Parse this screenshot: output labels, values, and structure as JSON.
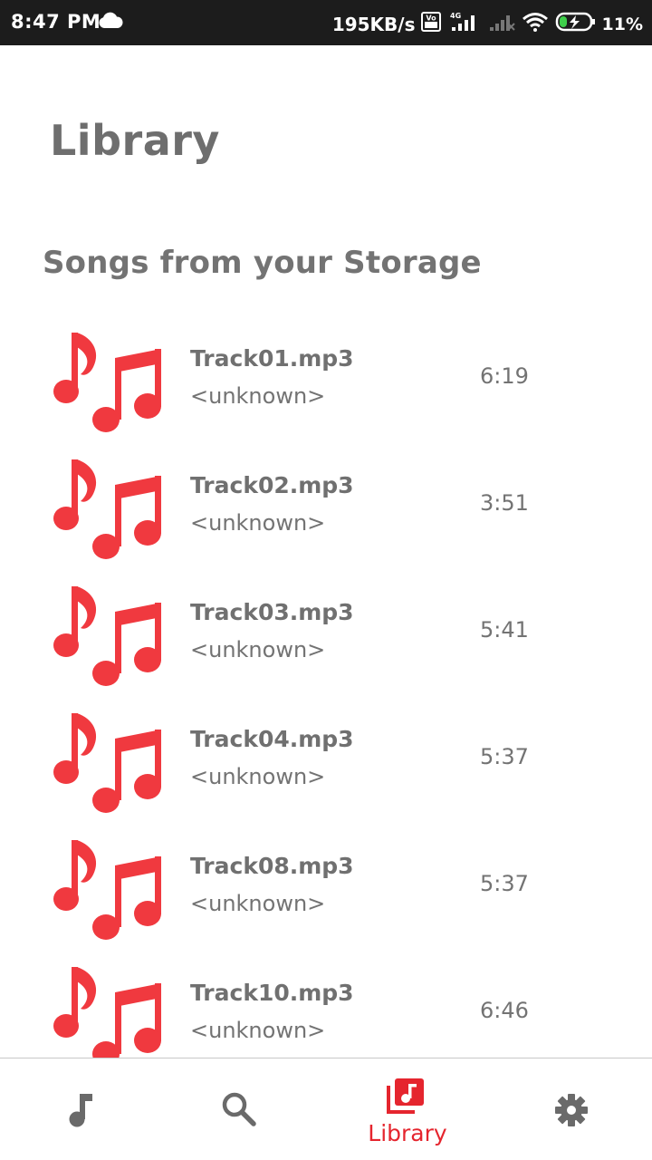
{
  "status_bar": {
    "time": "8:47 PM",
    "speed": "195KB/s",
    "battery": "11%",
    "icons": [
      "cloud-icon",
      "volte-icon",
      "signal-4g-icon",
      "signal-icon",
      "wifi-icon",
      "battery-charging-icon"
    ]
  },
  "header": {
    "title": "Library"
  },
  "section": {
    "title": "Songs from your Storage"
  },
  "songs": [
    {
      "title": "Track01.mp3",
      "artist": "<unknown>",
      "duration": "6:19"
    },
    {
      "title": "Track02.mp3",
      "artist": "<unknown>",
      "duration": "3:51"
    },
    {
      "title": "Track03.mp3",
      "artist": "<unknown>",
      "duration": "5:41"
    },
    {
      "title": "Track04.mp3",
      "artist": "<unknown>",
      "duration": "5:37"
    },
    {
      "title": "Track08.mp3",
      "artist": "<unknown>",
      "duration": "5:37"
    },
    {
      "title": "Track10.mp3",
      "artist": "<unknown>",
      "duration": "6:46"
    }
  ],
  "bottom_nav": {
    "items": [
      {
        "icon": "music-note-icon",
        "label": "",
        "active": false
      },
      {
        "icon": "search-icon",
        "label": "",
        "active": false
      },
      {
        "icon": "library-icon",
        "label": "Library",
        "active": true
      },
      {
        "icon": "gear-icon",
        "label": "",
        "active": false
      }
    ]
  },
  "colors": {
    "accent": "#e5252e",
    "icon_red": "#f0393f",
    "text_gray": "#707070",
    "nav_gray": "#6a6a6a",
    "status_bar_bg": "#1c1c1c"
  }
}
